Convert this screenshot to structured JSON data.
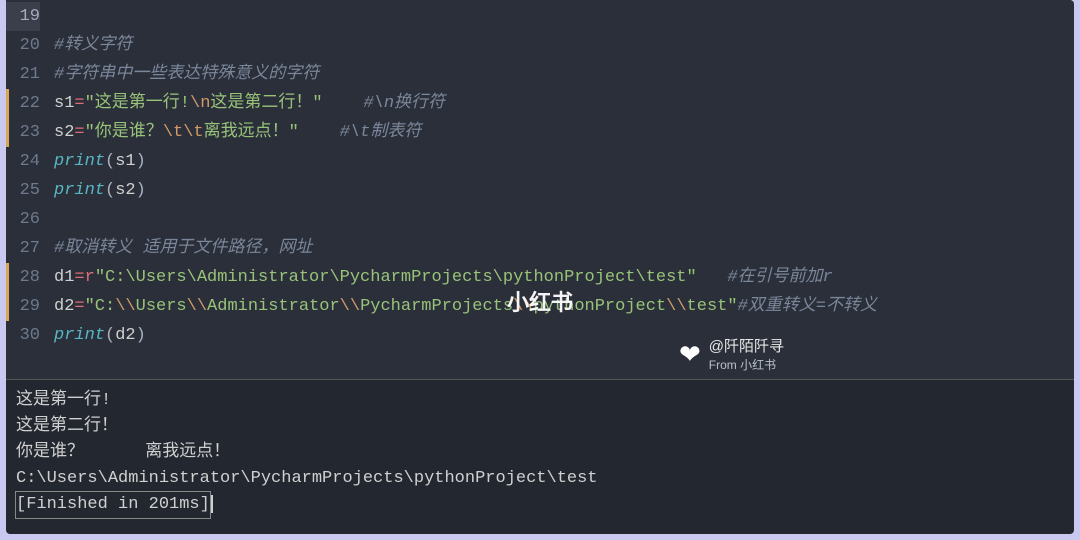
{
  "editor": {
    "lines": [
      {
        "num": 19,
        "hl": true,
        "modified": false,
        "tokens": []
      },
      {
        "num": 20,
        "hl": false,
        "modified": false,
        "tokens": [
          {
            "cls": "cmt",
            "t": "#转义字符"
          }
        ]
      },
      {
        "num": 21,
        "hl": false,
        "modified": false,
        "tokens": [
          {
            "cls": "cmt",
            "t": "#字符串中一些表达特殊意义的字符"
          }
        ]
      },
      {
        "num": 22,
        "hl": false,
        "modified": true,
        "tokens": [
          {
            "cls": "ident",
            "t": "s1"
          },
          {
            "cls": "op",
            "t": "="
          },
          {
            "cls": "str",
            "t": "\"这是第一行!"
          },
          {
            "cls": "esc",
            "t": "\\n"
          },
          {
            "cls": "str",
            "t": "这是第二行！\""
          },
          {
            "cls": "",
            "t": "    "
          },
          {
            "cls": "cmt",
            "t": "#\\n换行符"
          }
        ]
      },
      {
        "num": 23,
        "hl": false,
        "modified": true,
        "tokens": [
          {
            "cls": "ident",
            "t": "s2"
          },
          {
            "cls": "op",
            "t": "="
          },
          {
            "cls": "str",
            "t": "\"你是谁？"
          },
          {
            "cls": "esc",
            "t": "\\t\\t"
          },
          {
            "cls": "str",
            "t": "离我远点！\""
          },
          {
            "cls": "",
            "t": "    "
          },
          {
            "cls": "cmt",
            "t": "#\\t制表符"
          }
        ]
      },
      {
        "num": 24,
        "hl": false,
        "modified": false,
        "tokens": [
          {
            "cls": "fn",
            "t": "print"
          },
          {
            "cls": "pun",
            "t": "("
          },
          {
            "cls": "ident",
            "t": "s1"
          },
          {
            "cls": "pun",
            "t": ")"
          }
        ]
      },
      {
        "num": 25,
        "hl": false,
        "modified": false,
        "tokens": [
          {
            "cls": "fn",
            "t": "print"
          },
          {
            "cls": "pun",
            "t": "("
          },
          {
            "cls": "ident",
            "t": "s2"
          },
          {
            "cls": "pun",
            "t": ")"
          }
        ]
      },
      {
        "num": 26,
        "hl": false,
        "modified": false,
        "tokens": []
      },
      {
        "num": 27,
        "hl": false,
        "modified": false,
        "tokens": [
          {
            "cls": "cmt",
            "t": "#取消转义 适用于文件路径，网址"
          }
        ]
      },
      {
        "num": 28,
        "hl": false,
        "modified": true,
        "tokens": [
          {
            "cls": "ident",
            "t": "d1"
          },
          {
            "cls": "op",
            "t": "="
          },
          {
            "cls": "op",
            "t": "r"
          },
          {
            "cls": "str",
            "t": "\"C:\\Users\\Administrator\\PycharmProjects\\pythonProject\\test\""
          },
          {
            "cls": "",
            "t": "   "
          },
          {
            "cls": "cmt",
            "t": "#在引号前加r"
          }
        ]
      },
      {
        "num": 29,
        "hl": false,
        "modified": true,
        "tokens": [
          {
            "cls": "ident",
            "t": "d2"
          },
          {
            "cls": "op",
            "t": "="
          },
          {
            "cls": "str",
            "t": "\"C:"
          },
          {
            "cls": "esc",
            "t": "\\\\"
          },
          {
            "cls": "str",
            "t": "Users"
          },
          {
            "cls": "esc",
            "t": "\\\\"
          },
          {
            "cls": "str",
            "t": "Administrator"
          },
          {
            "cls": "esc",
            "t": "\\\\"
          },
          {
            "cls": "str",
            "t": "PycharmProjects"
          },
          {
            "cls": "esc",
            "t": "\\\\"
          },
          {
            "cls": "str",
            "t": "pythonProject"
          },
          {
            "cls": "esc",
            "t": "\\\\"
          },
          {
            "cls": "str",
            "t": "test\""
          },
          {
            "cls": "cmt",
            "t": "#双重转义=不转义"
          }
        ]
      },
      {
        "num": 30,
        "hl": false,
        "modified": false,
        "tokens": [
          {
            "cls": "fn",
            "t": "print"
          },
          {
            "cls": "pun",
            "t": "("
          },
          {
            "cls": "ident",
            "t": "d2"
          },
          {
            "cls": "pun",
            "t": ")"
          }
        ]
      }
    ]
  },
  "console": {
    "lines": [
      "这是第一行!",
      "这是第二行！",
      "你是谁？      离我远点！",
      "C:\\Users\\Administrator\\PycharmProjects\\pythonProject\\test"
    ],
    "finished": "[Finished in 201ms]"
  },
  "watermark": {
    "center": "小红书",
    "handle": "@阡陌阡寻",
    "from": "From 小红书"
  }
}
